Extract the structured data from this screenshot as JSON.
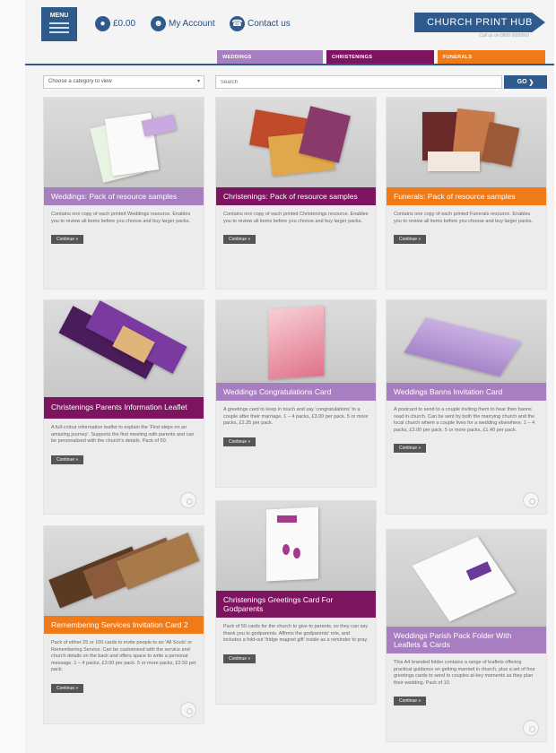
{
  "header": {
    "menu_label": "MENU",
    "basket_amount": "£0.00",
    "account_label": "My Account",
    "contact_label": "Contact us",
    "brand_name": "CHURCH PRINT HUB",
    "brand_subline": "Call us on 0800 0000000"
  },
  "tabs": [
    {
      "label": "WEDDINGS"
    },
    {
      "label": "CHRISTENINGS"
    },
    {
      "label": "FUNERALS"
    }
  ],
  "search": {
    "category_value": "Choose a category to view",
    "placeholder": "Search",
    "go_label": "GO"
  },
  "colors": {
    "weddings": "#a77fc0",
    "christenings": "#7d1460",
    "funerals": "#f07a18",
    "brand": "#2f5b8c"
  },
  "cards": [
    {
      "title": "Weddings: Pack of resource samples",
      "desc": "Contains one copy of each printed Weddings resource. Enables you to review all items before you choose and buy larger packs.",
      "btn": "Continue »"
    },
    {
      "title": "Christenings: Pack of resource samples",
      "desc": "Contains one copy of each printed Christenings resource. Enables you to review all items before you choose and buy larger packs.",
      "btn": "Continue »"
    },
    {
      "title": "Funerals: Pack of resource samples",
      "desc": "Contains one copy of each printed Funerals resource. Enables you to review all items before you choose and buy larger packs.",
      "btn": "Continue »"
    },
    {
      "title": "Christenings Parents Information Leaflet",
      "desc": "A full-colour information leaflet to explain the 'First steps on an amazing journey'. Supports the first meeting with parents and can be personalised with the church's details. Pack of 50.",
      "btn": "Continue »"
    },
    {
      "title": "Weddings Congratulations Card",
      "desc": "A greetings card to keep in touch and say 'congratulations' to a couple after their marriage. 1 – 4 packs, £3.00 per pack. 5 or more packs, £2.25 per pack.",
      "btn": "Continue »"
    },
    {
      "title": "Weddings Banns Invitation Card",
      "desc": "A postcard to send to a couple inviting them to hear their banns read in church. Can be sent by both the marrying church and the local church where a couple lives for a wedding elsewhere. 1 – 4 packs, £3.00 per pack. 5 or more packs, £1.40 per pack.",
      "btn": "Continue »"
    },
    {
      "title": "Remembering Services Invitation Card 2",
      "desc": "Pack of either 25 or 100 cards to invite people to an 'All Souls' or Remembering Service. Can be customised with the service and church details on the back and offers space to write a personal message. 1 – 4 packs, £3.00 per pack. 5 or more packs, £2.50 per pack.",
      "btn": "Continue »"
    },
    {
      "title": "Christenings Greetings Card For Godparents",
      "desc": "Pack of 50 cards for the church to give to parents, so they can say thank you to godparents. Affirms the godparents' role, and includes a fold-out 'fridge magnet gift' inside as a reminder to pray.",
      "btn": "Continue »"
    },
    {
      "title": "Weddings Parish Pack Folder With Leaflets & Cards",
      "desc": "This A4 branded folder contains a range of leaflets offering practical guidance on getting married in church, plus a set of four greetings cards to send to couples at key moments as they plan their wedding. Pack of 10.",
      "btn": "Continue »"
    }
  ]
}
